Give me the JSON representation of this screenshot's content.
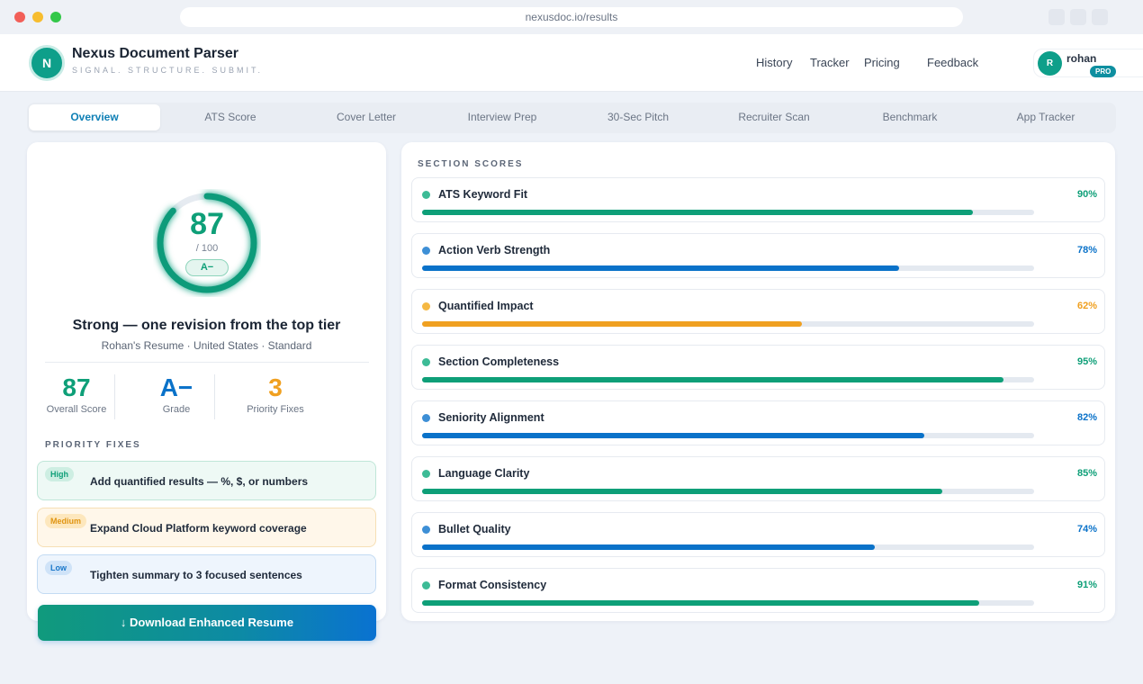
{
  "browser": {
    "url": "nexusdoc.io/results"
  },
  "header": {
    "logo_letter": "N",
    "title": "Nexus Document Parser",
    "tagline": "SIGNAL. STRUCTURE. SUBMIT.",
    "nav": [
      "History",
      "Tracker",
      "Pricing",
      "Feedback"
    ],
    "user": {
      "initial": "R",
      "name": "rohan",
      "plan": "PRO"
    }
  },
  "tabs": [
    "Overview",
    "ATS Score",
    "Cover Letter",
    "Interview Prep",
    "30-Sec Pitch",
    "Recruiter Scan",
    "Benchmark",
    "App Tracker"
  ],
  "active_tab": "Overview",
  "overview": {
    "score": "87",
    "score_of": "/ 100",
    "score_fraction": 0.87,
    "grade": "A−",
    "verdict": "Strong — one revision from the top tier",
    "meta": "Rohan's Resume · United States · Standard",
    "stats": [
      {
        "value": "87",
        "label": "Overall Score",
        "color": "#0e9f78"
      },
      {
        "value": "A−",
        "label": "Grade",
        "color": "#0a72c9"
      },
      {
        "value": "3",
        "label": "Priority Fixes",
        "color": "#f0a020"
      }
    ],
    "fixes_title": "PRIORITY FIXES",
    "fixes": [
      {
        "level": "High",
        "text": "Add quantified results — %, $, or numbers",
        "bg": "#eef9f5",
        "border": "#bfe6d8",
        "badge_bg": "#cdeee2",
        "badge_color": "#0e9f78"
      },
      {
        "level": "Medium",
        "text": "Expand Cloud Platform keyword coverage",
        "bg": "#fff7ea",
        "border": "#f6dfb5",
        "badge_bg": "#fde7bd",
        "badge_color": "#e09512"
      },
      {
        "level": "Low",
        "text": "Tighten summary to 3 focused sentences",
        "bg": "#eef5fd",
        "border": "#c3dbf3",
        "badge_bg": "#cfe3f8",
        "badge_color": "#1a77c9"
      }
    ],
    "download_label": "↓ Download Enhanced Resume"
  },
  "section_scores": {
    "title": "SECTION SCORES",
    "items": [
      {
        "name": "ATS Keyword Fit",
        "pct": "90%",
        "value": 90,
        "color": "#0e9f78",
        "dot": "#3dbb96"
      },
      {
        "name": "Action Verb Strength",
        "pct": "78%",
        "value": 78,
        "color": "#0a72c9",
        "dot": "#3d8fd6"
      },
      {
        "name": "Quantified Impact",
        "pct": "62%",
        "value": 62,
        "color": "#f0a020",
        "dot": "#f5b843"
      },
      {
        "name": "Section Completeness",
        "pct": "95%",
        "value": 95,
        "color": "#0e9f78",
        "dot": "#3dbb96"
      },
      {
        "name": "Seniority Alignment",
        "pct": "82%",
        "value": 82,
        "color": "#0a72c9",
        "dot": "#3d8fd6"
      },
      {
        "name": "Language Clarity",
        "pct": "85%",
        "value": 85,
        "color": "#0e9f78",
        "dot": "#3dbb96"
      },
      {
        "name": "Bullet Quality",
        "pct": "74%",
        "value": 74,
        "color": "#0a72c9",
        "dot": "#3d8fd6"
      },
      {
        "name": "Format Consistency",
        "pct": "91%",
        "value": 91,
        "color": "#0e9f78",
        "dot": "#3dbb96"
      }
    ]
  }
}
